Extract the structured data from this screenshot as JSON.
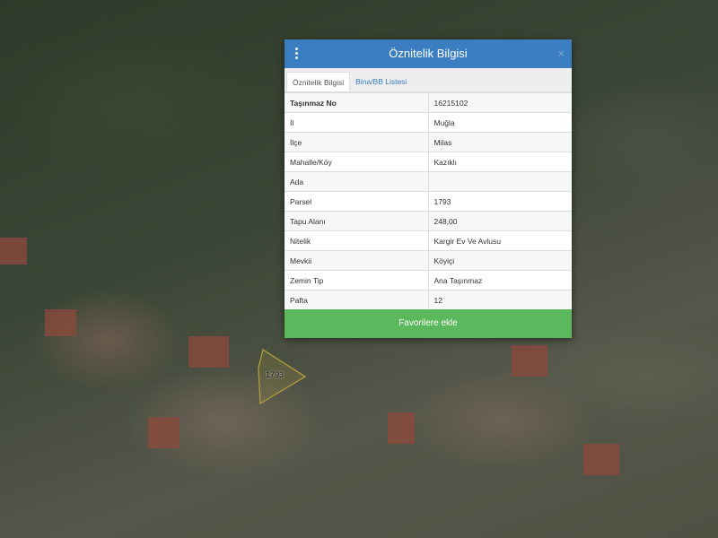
{
  "dialog": {
    "title": "Öznitelik Bilgisi",
    "close": "×",
    "tabs": [
      {
        "label": "Öznitelik Bilgisi"
      },
      {
        "label": "Bina/BB Listesi"
      }
    ],
    "rows": [
      {
        "label": "Taşınmaz No",
        "value": "16215102"
      },
      {
        "label": "İl",
        "value": "Muğla"
      },
      {
        "label": "İlçe",
        "value": "Milas"
      },
      {
        "label": "Mahalle/Köy",
        "value": "Kazıklı"
      },
      {
        "label": "Ada",
        "value": ""
      },
      {
        "label": "Parsel",
        "value": "1793"
      },
      {
        "label": "Tapu Alanı",
        "value": "248,00"
      },
      {
        "label": "Nitelik",
        "value": "Kargir Ev Ve Avlusu"
      },
      {
        "label": "Mevkii",
        "value": "Köyiçi"
      },
      {
        "label": "Zemin Tip",
        "value": "Ana Taşınmaz"
      },
      {
        "label": "Pafta",
        "value": "12"
      }
    ],
    "favorite_button": "Favorilere ekle"
  },
  "map": {
    "parcel_label": "1793"
  }
}
